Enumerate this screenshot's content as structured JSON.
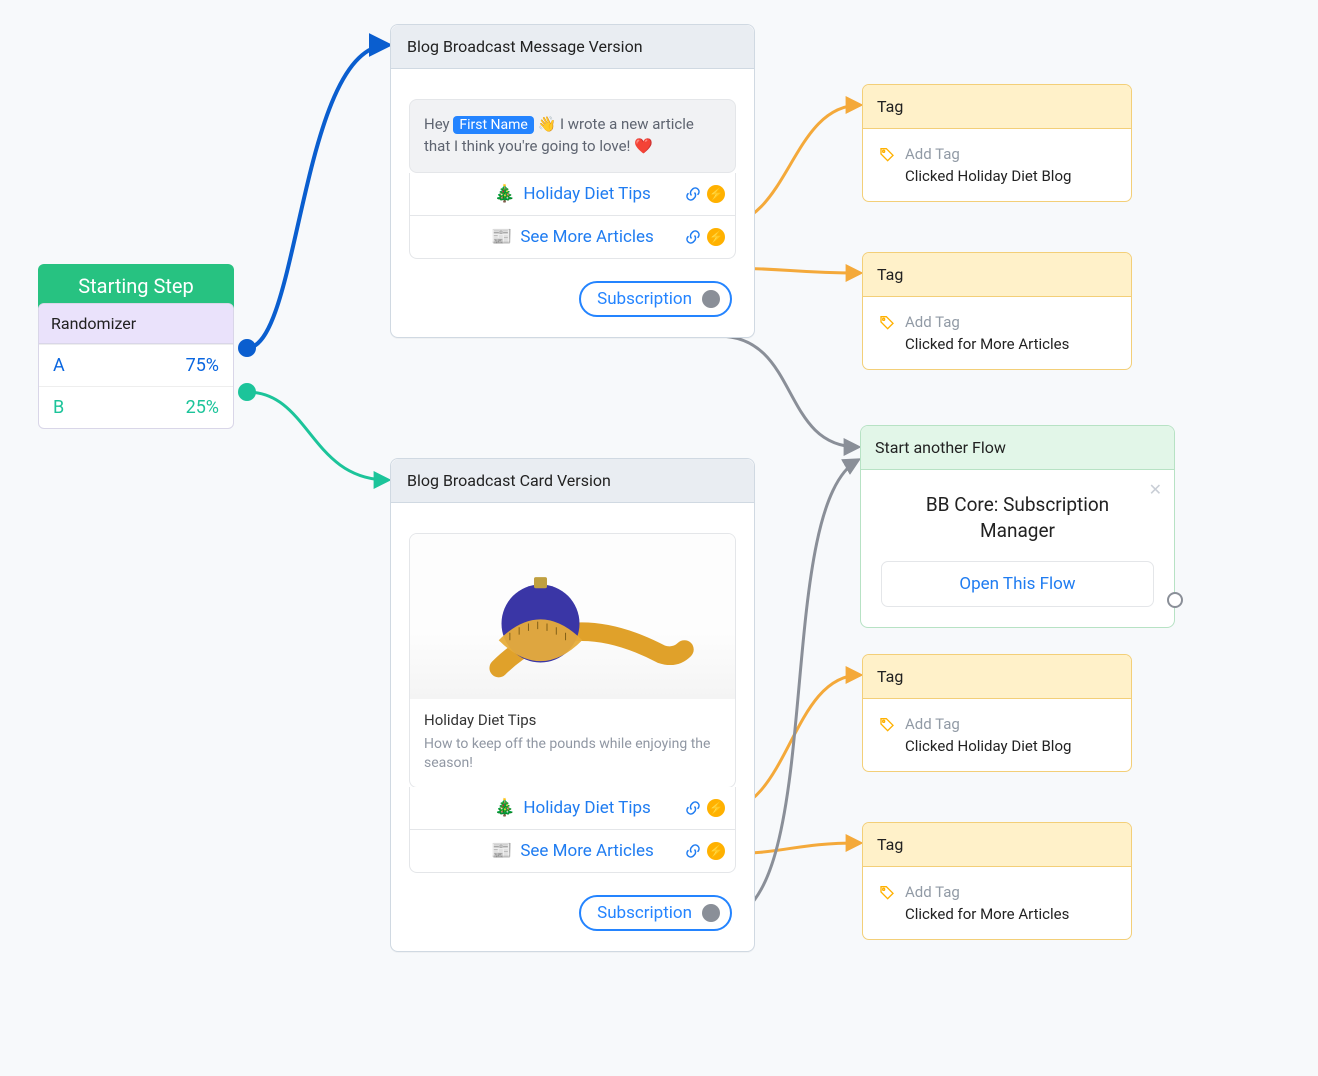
{
  "starter": {
    "title": "Starting Step",
    "randomizer_label": "Randomizer",
    "options": [
      {
        "key": "A",
        "pct": "75%"
      },
      {
        "key": "B",
        "pct": "25%"
      }
    ]
  },
  "messageBlock1": {
    "title": "Blog Broadcast Message Version",
    "bubble_pre": "Hey ",
    "bubble_chip": "First Name",
    "bubble_post": " 👋 I wrote a new article that I think you're going to love! ❤️",
    "buttons": [
      {
        "icon": "🎄",
        "label": "Holiday Diet Tips"
      },
      {
        "icon": "📰",
        "label": "See More Articles"
      }
    ],
    "subscription_label": "Subscription"
  },
  "messageBlock2": {
    "title": "Blog Broadcast Card Version",
    "card_title": "Holiday Diet Tips",
    "card_subtitle": "How to keep off the pounds while enjoying the season!",
    "buttons": [
      {
        "icon": "🎄",
        "label": "Holiday Diet Tips"
      },
      {
        "icon": "📰",
        "label": "See More Articles"
      }
    ],
    "subscription_label": "Subscription"
  },
  "tagNodes": {
    "head_label": "Tag",
    "add_label": "Add Tag",
    "items": [
      {
        "value": "Clicked Holiday Diet Blog"
      },
      {
        "value": "Clicked for More Articles"
      },
      {
        "value": "Clicked Holiday Diet Blog"
      },
      {
        "value": "Clicked for More Articles"
      }
    ]
  },
  "flowNode": {
    "head": "Start another Flow",
    "title": "BB Core: Subscription Manager",
    "cta": "Open This Flow"
  }
}
